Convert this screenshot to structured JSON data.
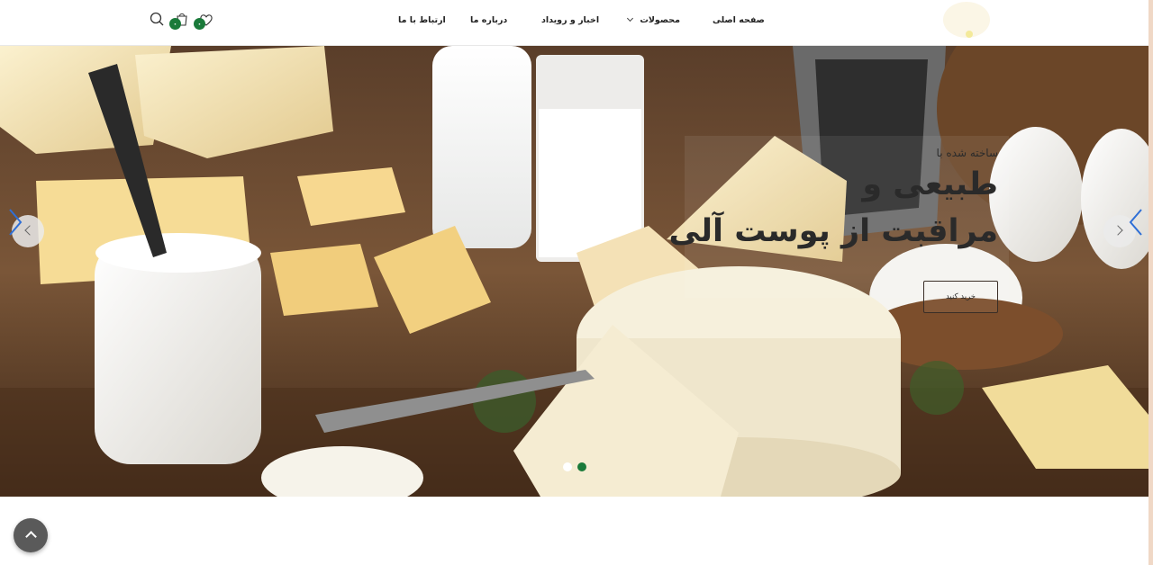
{
  "header": {
    "nav": [
      {
        "id": "home",
        "label": "صفحه اصلی"
      },
      {
        "id": "products",
        "label": "محصولات",
        "has_dropdown": true
      },
      {
        "id": "news",
        "label": "اخبار و رویداد"
      },
      {
        "id": "about",
        "label": "درباره ما"
      },
      {
        "id": "contact",
        "label": "ارتباط با ما"
      }
    ],
    "cart_count": "۰",
    "wishlist_count": "۰",
    "icons": [
      "search-icon",
      "cart-icon",
      "heart-icon",
      "logo"
    ]
  },
  "hero": {
    "subtitle": "ساخته شده با",
    "title_line1": "طبیعی و",
    "title_line2": "مراقبت از پوست آلی",
    "button_label": "خرید کنید",
    "slides": 2,
    "active_slide": 1
  },
  "colors": {
    "accent": "#1a7a3a",
    "arrow_blue": "#2f6fd6",
    "dark_text": "#2a2a2a"
  }
}
